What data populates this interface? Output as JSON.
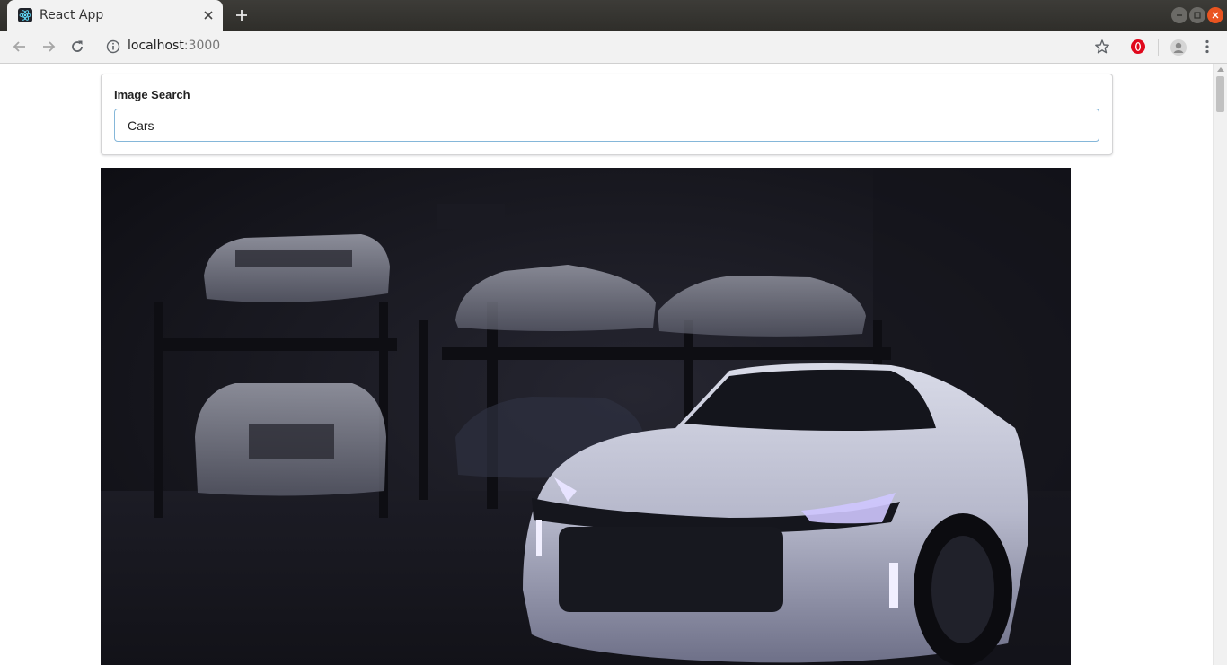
{
  "browser": {
    "tab_title": "React App",
    "url_host": "localhost",
    "url_port": ":3000"
  },
  "icons": {
    "favicon": "react-logo-icon",
    "tab_close": "close-icon",
    "new_tab": "plus-icon",
    "back": "arrow-left-icon",
    "forward": "arrow-right-icon",
    "reload": "reload-icon",
    "site_info": "info-icon",
    "bookmark": "star-icon",
    "extension": "opera-extension-icon",
    "profile": "profile-icon",
    "menu": "kebab-menu-icon"
  },
  "colors": {
    "input_border": "#85b7d9",
    "close_button": "#e95420"
  },
  "search": {
    "label": "Image Search",
    "value": "Cars"
  },
  "result": {
    "image_description": "car-photo"
  }
}
